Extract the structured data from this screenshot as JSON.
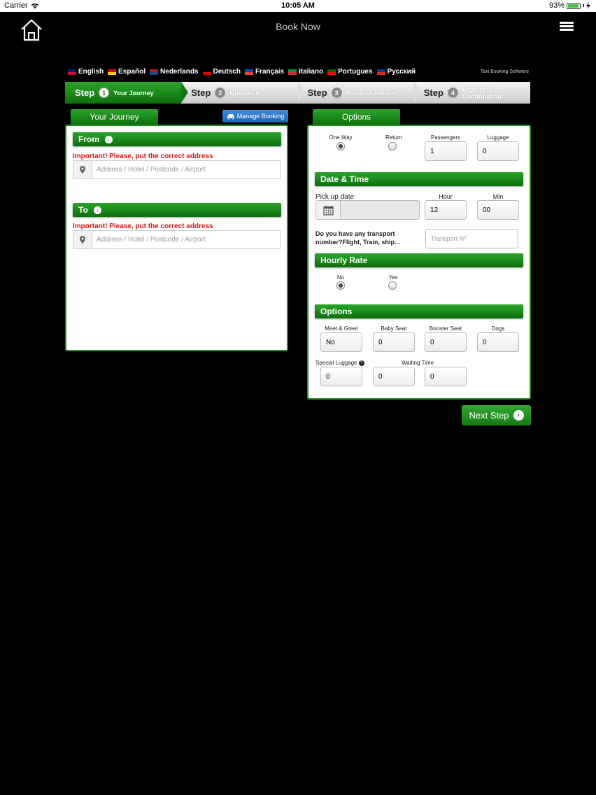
{
  "status_bar": {
    "carrier": "Carrier",
    "time": "10:05 AM",
    "battery": "93%",
    "battery_level": 0.93
  },
  "nav": {
    "title": "Book Now",
    "home_icon": "home-icon",
    "menu_icon": "hamburger-icon"
  },
  "languages": [
    {
      "label": "English",
      "colors": [
        "#012169",
        "#c8102e"
      ]
    },
    {
      "label": "Español",
      "colors": [
        "#c60b1e",
        "#ffc400"
      ]
    },
    {
      "label": "Nederlands",
      "colors": [
        "#ae1c28",
        "#21468b"
      ]
    },
    {
      "label": "Deutsch",
      "colors": [
        "#000000",
        "#dd0000"
      ]
    },
    {
      "label": "Français",
      "colors": [
        "#0055a4",
        "#ef4135"
      ]
    },
    {
      "label": "Italiano",
      "colors": [
        "#009246",
        "#ce2b37"
      ]
    },
    {
      "label": "Portugues",
      "colors": [
        "#006600",
        "#ff0000"
      ]
    },
    {
      "label": "Русский",
      "colors": [
        "#0039a6",
        "#d52b1e"
      ]
    }
  ],
  "software_label": "Taxi Booking Software",
  "steps": [
    {
      "word": "Step",
      "num": "1",
      "label": "Your Journey",
      "active": true
    },
    {
      "word": "Step",
      "num": "2",
      "label": "Quotation",
      "active": false
    },
    {
      "word": "Step",
      "num": "3",
      "label": "Personal Details",
      "active": false
    },
    {
      "word": "Step",
      "num": "4",
      "label": "Payment / Confirmation",
      "active": false
    }
  ],
  "journey": {
    "tab": "Your Journey",
    "manage_booking": "Manage Booking",
    "from_label": "From",
    "to_label": "To",
    "warning": "Important! Please, put the correct address",
    "address_placeholder": "Address / Hotel / Postcode / Airport"
  },
  "options": {
    "tab": "Options",
    "one_way": "One Way",
    "return": "Return",
    "passengers_label": "Passengers",
    "passengers_value": "1",
    "luggage_label": "Luggage",
    "luggage_value": "0",
    "date_time_title": "Date & Time",
    "pickup_label": "Pick up date",
    "hour_label": "Hour",
    "hour_value": "12",
    "min_label": "Min",
    "min_value": "00",
    "transport_question": "Do you have any transport number?Flight, Train, ship...",
    "transport_placeholder": "Transport Nº",
    "hourly_title": "Hourly Rate",
    "hourly_no": "No",
    "hourly_yes": "Yes",
    "options_title": "Options",
    "meet_label": "Meet & Greet",
    "meet_value": "No",
    "baby_label": "Baby Seat",
    "baby_value": "0",
    "booster_label": "Booster Seat",
    "booster_value": "0",
    "dogs_label": "Dogs",
    "dogs_value": "0",
    "special_label": "Special Luggage",
    "special_value": "0",
    "waiting_label": "Waiting Time",
    "waiting_value": "0"
  },
  "next_step": "Next Step"
}
